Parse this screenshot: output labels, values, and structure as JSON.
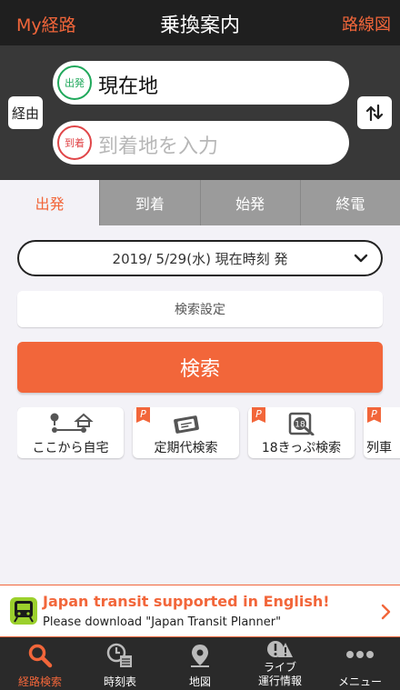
{
  "header": {
    "left_link": "My経路",
    "title": "乗換案内",
    "right_link": "路線図"
  },
  "route": {
    "via_label": "経由",
    "from": {
      "badge": "出発",
      "value": "現在地"
    },
    "to": {
      "badge": "到着",
      "placeholder": "到着地を入力"
    }
  },
  "tabs": [
    {
      "label": "出発",
      "active": true
    },
    {
      "label": "到着"
    },
    {
      "label": "始発"
    },
    {
      "label": "終電"
    }
  ],
  "date_select": {
    "value": "2019/ 5/29(水) 現在時刻 発"
  },
  "settings_label": "検索設定",
  "search_label": "検索",
  "shortcuts": [
    {
      "label": "ここから自宅",
      "icon": "home-route-icon",
      "premium": false
    },
    {
      "label": "定期代検索",
      "icon": "commuter-pass-icon",
      "premium": true
    },
    {
      "label": "18きっぷ検索",
      "icon": "18-ticket-icon",
      "premium": true
    },
    {
      "label": "列車",
      "icon": "train-icon",
      "premium": true
    }
  ],
  "premium_mark": "P",
  "banner": {
    "title": "Japan transit supported in English!",
    "subtitle": "Please download \"Japan Transit Planner\""
  },
  "nav": [
    {
      "label": "経路検索",
      "icon": "search-icon",
      "active": true
    },
    {
      "label": "時刻表",
      "icon": "timetable-icon"
    },
    {
      "label": "地図",
      "icon": "map-pin-icon"
    },
    {
      "label": "ライブ\n運行情報",
      "icon": "live-alert-icon"
    },
    {
      "label": "メニュー",
      "icon": "more-icon"
    }
  ],
  "colors": {
    "accent": "#f2663a",
    "departure": "#1fa85b",
    "arrival": "#e04548",
    "header_bg": "#1f1f1f",
    "nav_bg": "#2a2a2a"
  }
}
